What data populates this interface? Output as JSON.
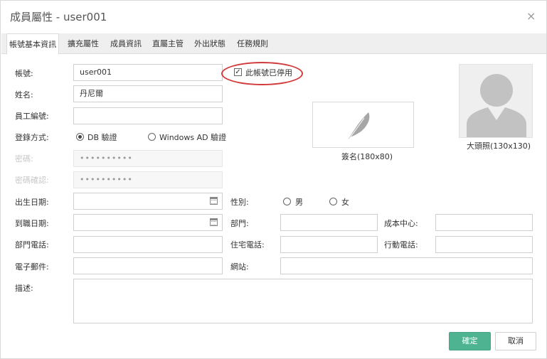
{
  "dialog": {
    "title": "成員屬性 - user001",
    "close_glyph": "×"
  },
  "tabs": [
    {
      "label": "帳號基本資訊",
      "active": true
    },
    {
      "label": "擴充屬性"
    },
    {
      "label": "成員資訊"
    },
    {
      "label": "直屬主管"
    },
    {
      "label": "外出狀態"
    },
    {
      "label": "任務規則"
    }
  ],
  "form": {
    "account": {
      "label": "帳號:",
      "value": "user001"
    },
    "disabled_check": {
      "label": "此帳號已停用",
      "checked": true,
      "glyph": "✓"
    },
    "name": {
      "label": "姓名:",
      "value": "丹尼爾"
    },
    "employee_no": {
      "label": "員工編號:",
      "value": ""
    },
    "login_method": {
      "label": "登錄方式:",
      "options": [
        {
          "label": "DB 驗證",
          "selected": true
        },
        {
          "label": "Windows AD 驗證",
          "selected": false
        }
      ]
    },
    "password": {
      "label": "密碼:",
      "value": "••••••••••"
    },
    "password_confirm": {
      "label": "密碼確認:",
      "value": "••••••••••"
    },
    "birth_date": {
      "label": "出生日期:",
      "value": ""
    },
    "gender": {
      "label": "性別:",
      "options": [
        {
          "label": "男",
          "selected": false
        },
        {
          "label": "女",
          "selected": false
        }
      ]
    },
    "hire_date": {
      "label": "到職日期:",
      "value": ""
    },
    "department": {
      "label": "部門:",
      "value": ""
    },
    "cost_center": {
      "label": "成本中心:",
      "value": ""
    },
    "dept_phone": {
      "label": "部門電話:",
      "value": ""
    },
    "home_phone": {
      "label": "住宅電話:",
      "value": ""
    },
    "mobile_phone": {
      "label": "行動電話:",
      "value": ""
    },
    "email": {
      "label": "電子郵件:",
      "value": ""
    },
    "website": {
      "label": "網站:",
      "value": ""
    },
    "description": {
      "label": "描述:",
      "value": ""
    }
  },
  "signature": {
    "caption": "簽名(180x80)",
    "icon": "feather-icon"
  },
  "photo": {
    "caption": "大頭照(130x130)",
    "icon": "avatar-silhouette-icon"
  },
  "buttons": {
    "ok": "確定",
    "cancel": "取消"
  },
  "colors": {
    "primary": "#4db391",
    "highlight": "#d23a3a",
    "tabbar": "#efefef"
  }
}
